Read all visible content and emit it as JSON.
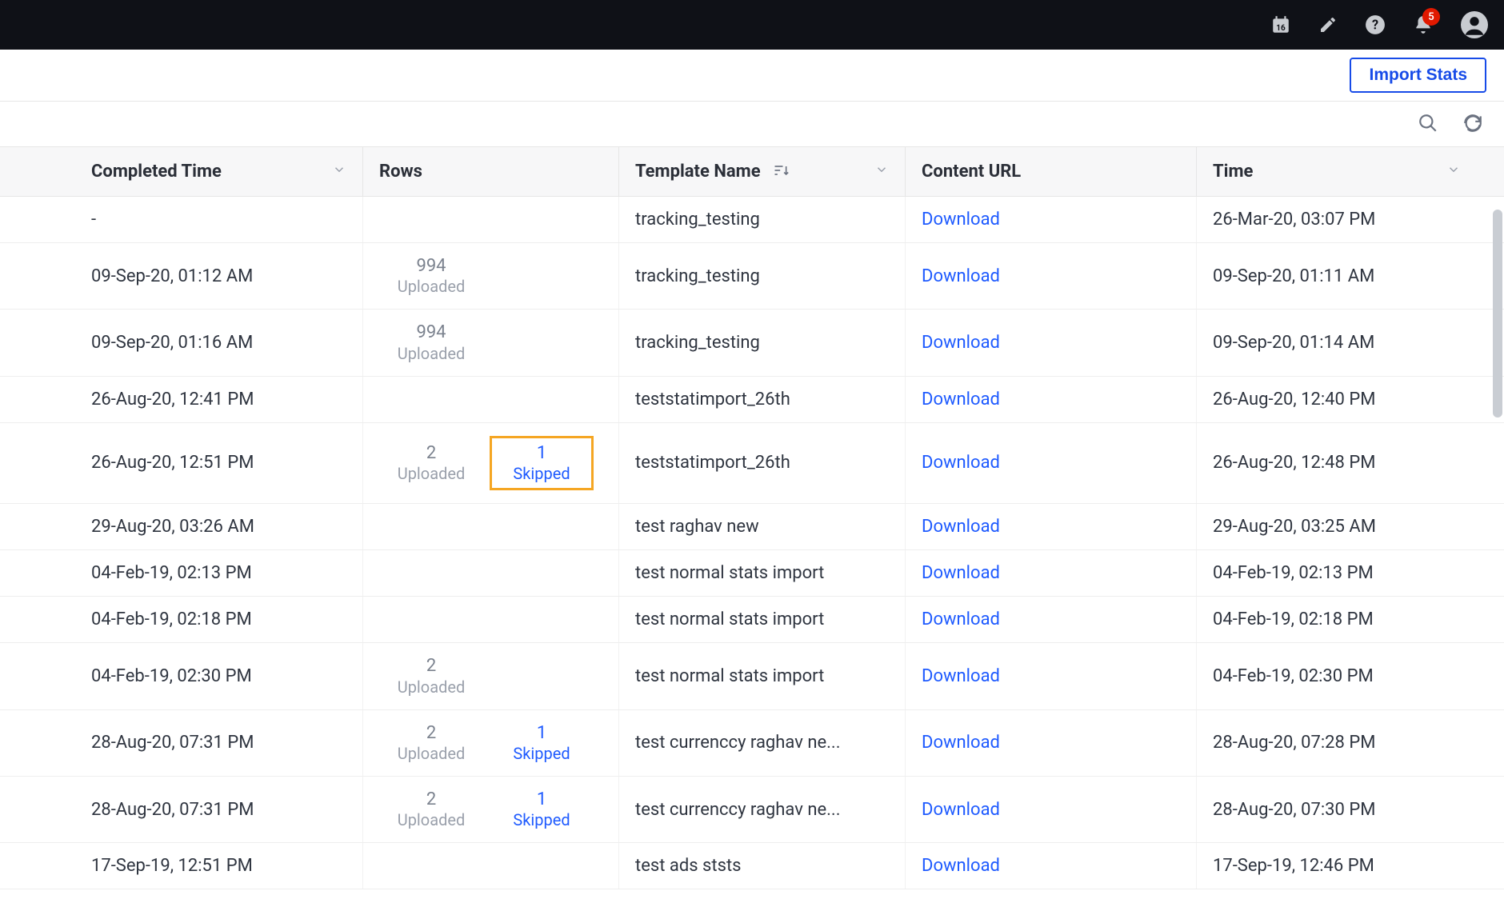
{
  "topbar": {
    "calendar_day": "16",
    "notification_count": "5"
  },
  "actions": {
    "import_stats_label": "Import Stats"
  },
  "table": {
    "columns": {
      "completed_time": "Completed Time",
      "rows": "Rows",
      "template_name": "Template Name",
      "content_url": "Content URL",
      "time": "Time"
    },
    "uploaded_label": "Uploaded",
    "skipped_label": "Skipped",
    "download_label": "Download",
    "rows_data": [
      {
        "completed": "-",
        "uploaded": "",
        "skipped": "",
        "template": "tracking_testing",
        "download": true,
        "time": "26-Mar-20, 03:07 PM",
        "highlight": false
      },
      {
        "completed": "09-Sep-20, 01:12 AM",
        "uploaded": "994",
        "skipped": "",
        "template": "tracking_testing",
        "download": true,
        "time": "09-Sep-20, 01:11 AM",
        "highlight": false
      },
      {
        "completed": "09-Sep-20, 01:16 AM",
        "uploaded": "994",
        "skipped": "",
        "template": "tracking_testing",
        "download": true,
        "time": "09-Sep-20, 01:14 AM",
        "highlight": false
      },
      {
        "completed": "26-Aug-20, 12:41 PM",
        "uploaded": "",
        "skipped": "",
        "template": "teststatimport_26th",
        "download": true,
        "time": "26-Aug-20, 12:40 PM",
        "highlight": false
      },
      {
        "completed": "26-Aug-20, 12:51 PM",
        "uploaded": "2",
        "skipped": "1",
        "template": "teststatimport_26th",
        "download": true,
        "time": "26-Aug-20, 12:48 PM",
        "highlight": true
      },
      {
        "completed": "29-Aug-20, 03:26 AM",
        "uploaded": "",
        "skipped": "",
        "template": "test raghav new",
        "download": true,
        "time": "29-Aug-20, 03:25 AM",
        "highlight": false
      },
      {
        "completed": "04-Feb-19, 02:13 PM",
        "uploaded": "",
        "skipped": "",
        "template": "test normal stats import",
        "download": true,
        "time": "04-Feb-19, 02:13 PM",
        "highlight": false
      },
      {
        "completed": "04-Feb-19, 02:18 PM",
        "uploaded": "",
        "skipped": "",
        "template": "test normal stats import",
        "download": true,
        "time": "04-Feb-19, 02:18 PM",
        "highlight": false
      },
      {
        "completed": "04-Feb-19, 02:30 PM",
        "uploaded": "2",
        "skipped": "",
        "template": "test normal stats import",
        "download": true,
        "time": "04-Feb-19, 02:30 PM",
        "highlight": false
      },
      {
        "completed": "28-Aug-20, 07:31 PM",
        "uploaded": "2",
        "skipped": "1",
        "template": "test currenccy raghav ne...",
        "download": true,
        "time": "28-Aug-20, 07:28 PM",
        "highlight": false
      },
      {
        "completed": "28-Aug-20, 07:31 PM",
        "uploaded": "2",
        "skipped": "1",
        "template": "test currenccy raghav ne...",
        "download": true,
        "time": "28-Aug-20, 07:30 PM",
        "highlight": false
      },
      {
        "completed": "17-Sep-19, 12:51 PM",
        "uploaded": "",
        "skipped": "",
        "template": "test ads ststs",
        "download": true,
        "time": "17-Sep-19, 12:46 PM",
        "highlight": false
      }
    ]
  }
}
